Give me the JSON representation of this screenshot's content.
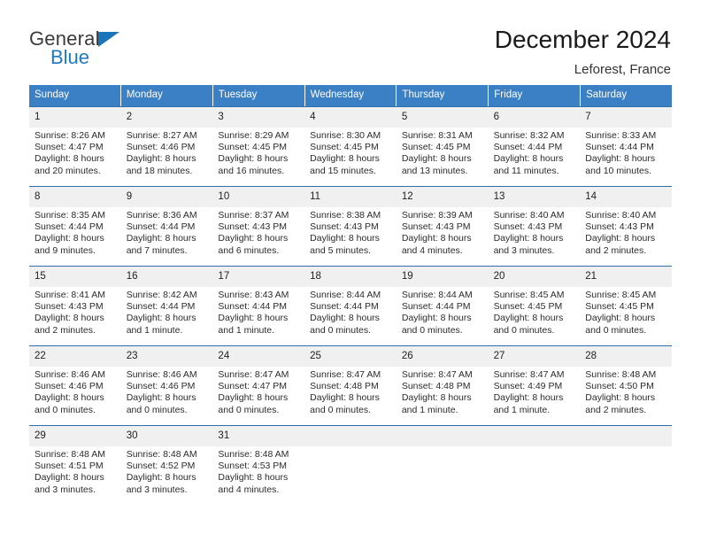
{
  "brand": {
    "name_top": "General",
    "name_bottom": "Blue",
    "triangle_color": "#1b75bb"
  },
  "header": {
    "title": "December 2024",
    "location": "Leforest, France"
  },
  "theme": {
    "header_bg": "#3b7fc4",
    "rule_color": "#2f6fae",
    "daynum_bg": "#f0f0f0"
  },
  "weekdays": [
    "Sunday",
    "Monday",
    "Tuesday",
    "Wednesday",
    "Thursday",
    "Friday",
    "Saturday"
  ],
  "weeks": [
    {
      "days": [
        {
          "num": "1",
          "l1": "Sunrise: 8:26 AM",
          "l2": "Sunset: 4:47 PM",
          "l3": "Daylight: 8 hours",
          "l4": "and 20 minutes."
        },
        {
          "num": "2",
          "l1": "Sunrise: 8:27 AM",
          "l2": "Sunset: 4:46 PM",
          "l3": "Daylight: 8 hours",
          "l4": "and 18 minutes."
        },
        {
          "num": "3",
          "l1": "Sunrise: 8:29 AM",
          "l2": "Sunset: 4:45 PM",
          "l3": "Daylight: 8 hours",
          "l4": "and 16 minutes."
        },
        {
          "num": "4",
          "l1": "Sunrise: 8:30 AM",
          "l2": "Sunset: 4:45 PM",
          "l3": "Daylight: 8 hours",
          "l4": "and 15 minutes."
        },
        {
          "num": "5",
          "l1": "Sunrise: 8:31 AM",
          "l2": "Sunset: 4:45 PM",
          "l3": "Daylight: 8 hours",
          "l4": "and 13 minutes."
        },
        {
          "num": "6",
          "l1": "Sunrise: 8:32 AM",
          "l2": "Sunset: 4:44 PM",
          "l3": "Daylight: 8 hours",
          "l4": "and 11 minutes."
        },
        {
          "num": "7",
          "l1": "Sunrise: 8:33 AM",
          "l2": "Sunset: 4:44 PM",
          "l3": "Daylight: 8 hours",
          "l4": "and 10 minutes."
        }
      ]
    },
    {
      "days": [
        {
          "num": "8",
          "l1": "Sunrise: 8:35 AM",
          "l2": "Sunset: 4:44 PM",
          "l3": "Daylight: 8 hours",
          "l4": "and 9 minutes."
        },
        {
          "num": "9",
          "l1": "Sunrise: 8:36 AM",
          "l2": "Sunset: 4:44 PM",
          "l3": "Daylight: 8 hours",
          "l4": "and 7 minutes."
        },
        {
          "num": "10",
          "l1": "Sunrise: 8:37 AM",
          "l2": "Sunset: 4:43 PM",
          "l3": "Daylight: 8 hours",
          "l4": "and 6 minutes."
        },
        {
          "num": "11",
          "l1": "Sunrise: 8:38 AM",
          "l2": "Sunset: 4:43 PM",
          "l3": "Daylight: 8 hours",
          "l4": "and 5 minutes."
        },
        {
          "num": "12",
          "l1": "Sunrise: 8:39 AM",
          "l2": "Sunset: 4:43 PM",
          "l3": "Daylight: 8 hours",
          "l4": "and 4 minutes."
        },
        {
          "num": "13",
          "l1": "Sunrise: 8:40 AM",
          "l2": "Sunset: 4:43 PM",
          "l3": "Daylight: 8 hours",
          "l4": "and 3 minutes."
        },
        {
          "num": "14",
          "l1": "Sunrise: 8:40 AM",
          "l2": "Sunset: 4:43 PM",
          "l3": "Daylight: 8 hours",
          "l4": "and 2 minutes."
        }
      ]
    },
    {
      "days": [
        {
          "num": "15",
          "l1": "Sunrise: 8:41 AM",
          "l2": "Sunset: 4:43 PM",
          "l3": "Daylight: 8 hours",
          "l4": "and 2 minutes."
        },
        {
          "num": "16",
          "l1": "Sunrise: 8:42 AM",
          "l2": "Sunset: 4:44 PM",
          "l3": "Daylight: 8 hours",
          "l4": "and 1 minute."
        },
        {
          "num": "17",
          "l1": "Sunrise: 8:43 AM",
          "l2": "Sunset: 4:44 PM",
          "l3": "Daylight: 8 hours",
          "l4": "and 1 minute."
        },
        {
          "num": "18",
          "l1": "Sunrise: 8:44 AM",
          "l2": "Sunset: 4:44 PM",
          "l3": "Daylight: 8 hours",
          "l4": "and 0 minutes."
        },
        {
          "num": "19",
          "l1": "Sunrise: 8:44 AM",
          "l2": "Sunset: 4:44 PM",
          "l3": "Daylight: 8 hours",
          "l4": "and 0 minutes."
        },
        {
          "num": "20",
          "l1": "Sunrise: 8:45 AM",
          "l2": "Sunset: 4:45 PM",
          "l3": "Daylight: 8 hours",
          "l4": "and 0 minutes."
        },
        {
          "num": "21",
          "l1": "Sunrise: 8:45 AM",
          "l2": "Sunset: 4:45 PM",
          "l3": "Daylight: 8 hours",
          "l4": "and 0 minutes."
        }
      ]
    },
    {
      "days": [
        {
          "num": "22",
          "l1": "Sunrise: 8:46 AM",
          "l2": "Sunset: 4:46 PM",
          "l3": "Daylight: 8 hours",
          "l4": "and 0 minutes."
        },
        {
          "num": "23",
          "l1": "Sunrise: 8:46 AM",
          "l2": "Sunset: 4:46 PM",
          "l3": "Daylight: 8 hours",
          "l4": "and 0 minutes."
        },
        {
          "num": "24",
          "l1": "Sunrise: 8:47 AM",
          "l2": "Sunset: 4:47 PM",
          "l3": "Daylight: 8 hours",
          "l4": "and 0 minutes."
        },
        {
          "num": "25",
          "l1": "Sunrise: 8:47 AM",
          "l2": "Sunset: 4:48 PM",
          "l3": "Daylight: 8 hours",
          "l4": "and 0 minutes."
        },
        {
          "num": "26",
          "l1": "Sunrise: 8:47 AM",
          "l2": "Sunset: 4:48 PM",
          "l3": "Daylight: 8 hours",
          "l4": "and 1 minute."
        },
        {
          "num": "27",
          "l1": "Sunrise: 8:47 AM",
          "l2": "Sunset: 4:49 PM",
          "l3": "Daylight: 8 hours",
          "l4": "and 1 minute."
        },
        {
          "num": "28",
          "l1": "Sunrise: 8:48 AM",
          "l2": "Sunset: 4:50 PM",
          "l3": "Daylight: 8 hours",
          "l4": "and 2 minutes."
        }
      ]
    },
    {
      "days": [
        {
          "num": "29",
          "l1": "Sunrise: 8:48 AM",
          "l2": "Sunset: 4:51 PM",
          "l3": "Daylight: 8 hours",
          "l4": "and 3 minutes."
        },
        {
          "num": "30",
          "l1": "Sunrise: 8:48 AM",
          "l2": "Sunset: 4:52 PM",
          "l3": "Daylight: 8 hours",
          "l4": "and 3 minutes."
        },
        {
          "num": "31",
          "l1": "Sunrise: 8:48 AM",
          "l2": "Sunset: 4:53 PM",
          "l3": "Daylight: 8 hours",
          "l4": "and 4 minutes."
        },
        {
          "num": "",
          "l1": "",
          "l2": "",
          "l3": "",
          "l4": ""
        },
        {
          "num": "",
          "l1": "",
          "l2": "",
          "l3": "",
          "l4": ""
        },
        {
          "num": "",
          "l1": "",
          "l2": "",
          "l3": "",
          "l4": ""
        },
        {
          "num": "",
          "l1": "",
          "l2": "",
          "l3": "",
          "l4": ""
        }
      ]
    }
  ]
}
